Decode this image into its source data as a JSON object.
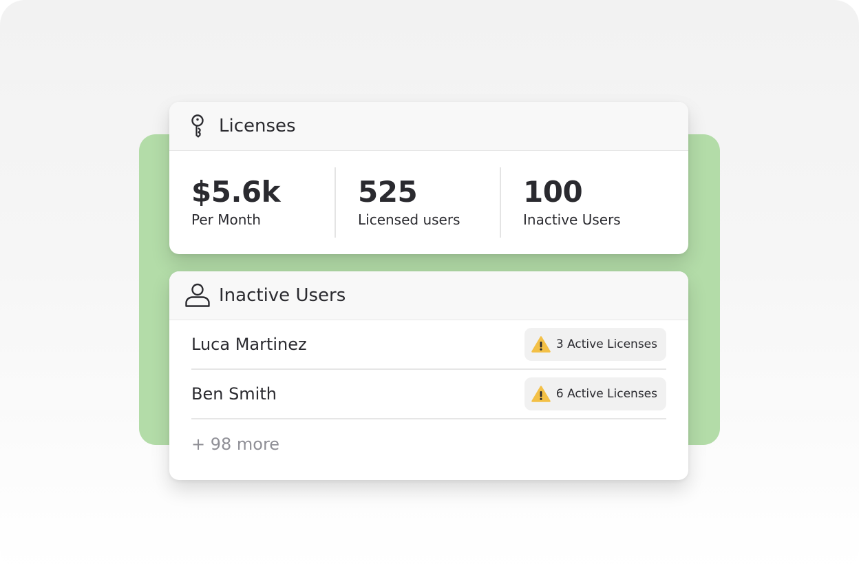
{
  "licenses_card": {
    "title": "Licenses",
    "icon": "key-icon",
    "stats": [
      {
        "value": "$5.6k",
        "label": "Per Month"
      },
      {
        "value": "525",
        "label": "Licensed users"
      },
      {
        "value": "100",
        "label": "Inactive Users"
      }
    ]
  },
  "inactive_card": {
    "title": "Inactive Users",
    "icon": "user-icon",
    "users": [
      {
        "name": "Luca Martinez",
        "badge": "3 Active Licenses",
        "badge_icon": "warning-icon"
      },
      {
        "name": "Ben Smith",
        "badge": "6 Active Licenses",
        "badge_icon": "warning-icon"
      }
    ],
    "more": "+ 98 more"
  },
  "colors": {
    "accent_plate": "#b3dca8",
    "warning": "#f3c046",
    "text": "#2a2a2f",
    "muted": "#8f8f96"
  }
}
